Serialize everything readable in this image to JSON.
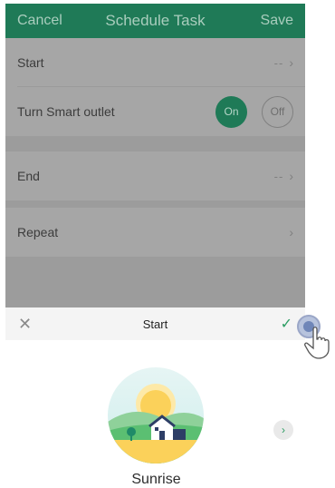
{
  "nav": {
    "cancel": "Cancel",
    "title": "Schedule Task",
    "save": "Save"
  },
  "rows": {
    "start": {
      "label": "Start",
      "value": "--",
      "chev": "›"
    },
    "outlet": {
      "label": "Turn Smart outlet",
      "on": "On",
      "off": "Off"
    },
    "end": {
      "label": "End",
      "value": "--",
      "chev": "›"
    },
    "repeat": {
      "label": "Repeat",
      "chev": "›"
    }
  },
  "picker": {
    "close_glyph": "✕",
    "title": "Start",
    "confirm_glyph": "✓",
    "next_glyph": "›"
  },
  "selection": {
    "caption": "Sunrise"
  },
  "colors": {
    "brand": "#1f7a57",
    "confirm": "#2c9d63"
  },
  "icons": [
    "close-icon",
    "check-icon",
    "chevron-right-icon",
    "sunrise-illustration",
    "pointer-hand-icon"
  ]
}
